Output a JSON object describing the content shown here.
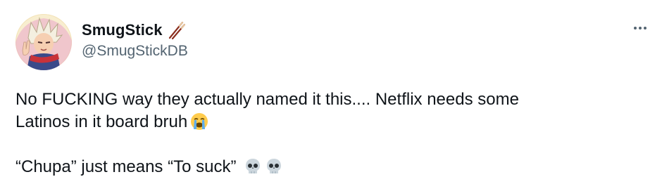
{
  "author": {
    "display_name": "SmugStick",
    "handle": "@SmugStickDB",
    "name_emoji": "chopsticks-icon",
    "avatar": "anime-character-avatar"
  },
  "tweet": {
    "line1": "No FUCKING way they actually named it this.... Netflix needs some",
    "line2": "Latinos in it board bruh",
    "line2_emoji": "loudly-crying-face-icon",
    "line3": "“Chupa” just means “To suck”",
    "line3_emojis": [
      "skull-icon",
      "skull-icon"
    ]
  },
  "more_menu": {
    "icon": "more-horizontal-icon"
  }
}
